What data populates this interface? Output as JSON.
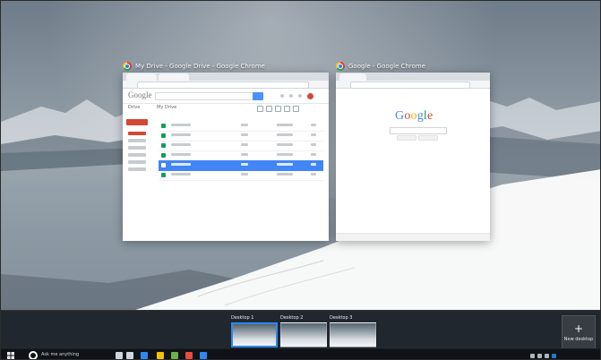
{
  "windows": [
    {
      "title": "My Drive - Google Drive - Google Chrome"
    },
    {
      "title": "Google - Google Chrome"
    }
  ],
  "google": {
    "logo_letters": [
      "G",
      "o",
      "o",
      "g",
      "l",
      "e"
    ]
  },
  "task_view": {
    "desktops": [
      {
        "label": "Desktop 1"
      },
      {
        "label": "Desktop 2"
      },
      {
        "label": "Desktop 3"
      }
    ],
    "new_desktop": {
      "plus": "+",
      "label": "New desktop"
    }
  },
  "taskbar": {
    "search_text": "Ask me anything"
  },
  "icons": {
    "start": "windows-start-icon",
    "cortana": "cortana-icon",
    "new_desktop": "plus-icon",
    "app": "chrome-icon"
  },
  "colors": {
    "accent_blue": "#2d89ef",
    "drive_select": "#4285f4",
    "drive_new": "#d14836"
  }
}
